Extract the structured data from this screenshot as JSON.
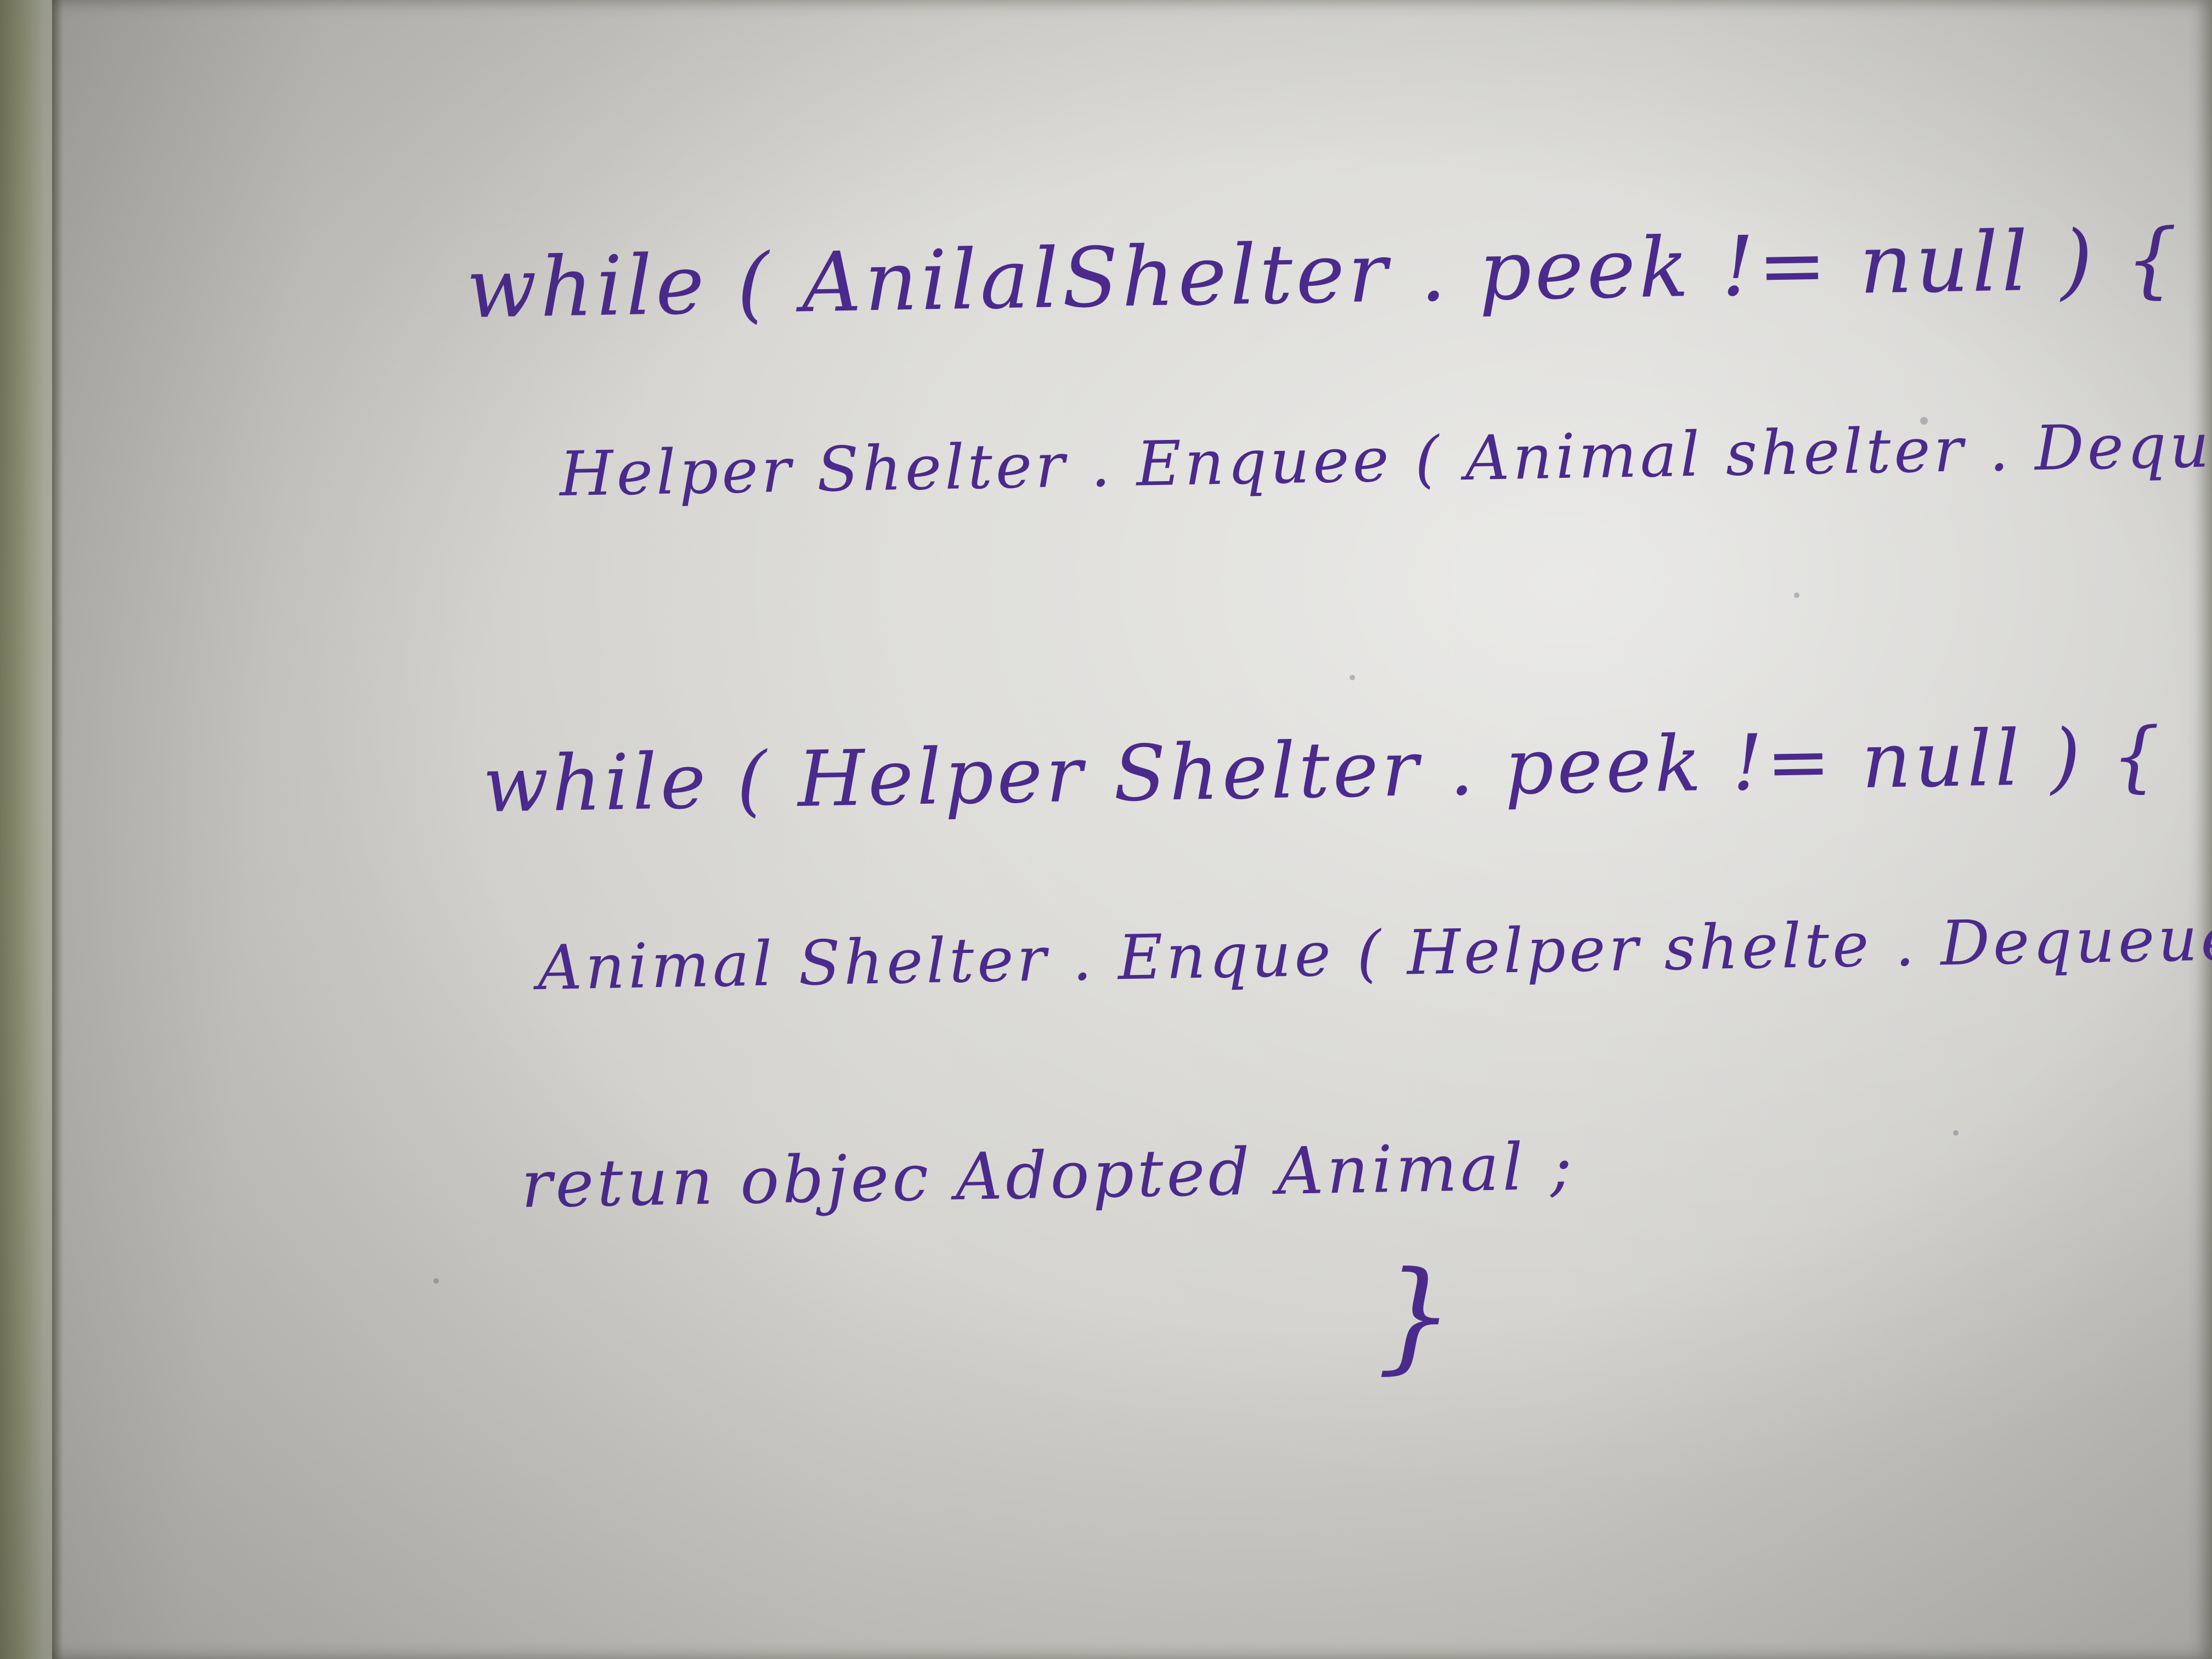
{
  "handwriting": {
    "line_1": "while ( AnilalShelter . peek != null ) {",
    "line_2": "Helper Shelter . Enquee ( Animal shelter . Dequeue() }",
    "line_3": "while ( Helper Shelter . peek != null ) {",
    "line_4": "Animal Shelter . Enque ( Helper shelte . Dequeue() }",
    "line_5": "retun objec Adopted Animal ;",
    "line_6": "}"
  },
  "colors": {
    "ink": "#4a2a8c",
    "paper": "#d3d2cd",
    "background": "#8a8c6a"
  }
}
